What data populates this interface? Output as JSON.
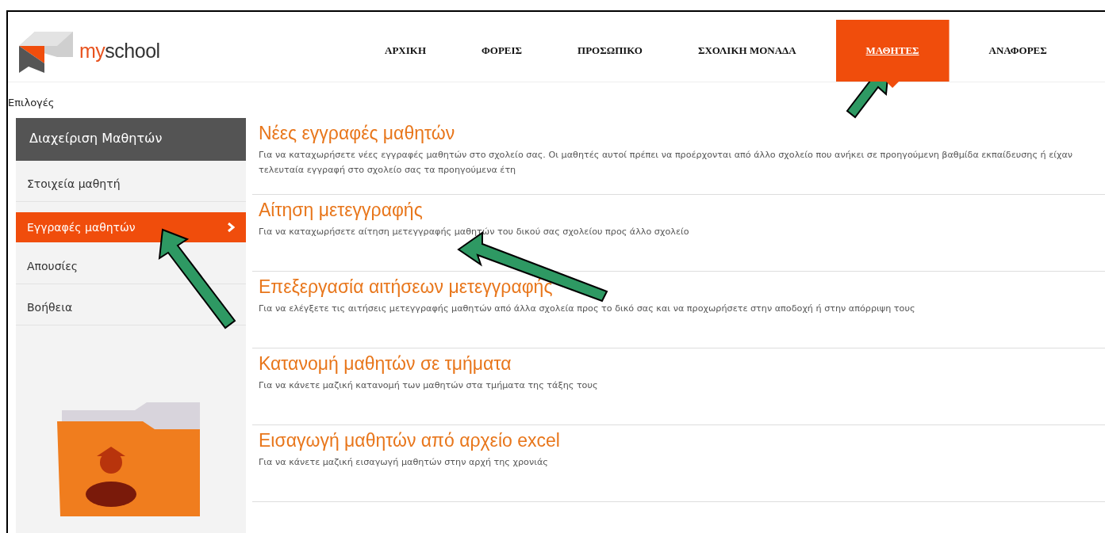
{
  "brand": {
    "name": "myschool"
  },
  "nav": [
    {
      "label": "ΑΡΧΙΚΗ",
      "selected": false
    },
    {
      "label": "ΦΟΡΕΙΣ",
      "selected": false
    },
    {
      "label": "ΠΡΟΣΩΠΙΚΟ",
      "selected": false
    },
    {
      "label": "ΣΧΟΛΙΚΗ ΜΟΝΑΔΑ",
      "selected": false
    },
    {
      "label": "ΜΑΘΗΤΕΣ",
      "selected": true
    },
    {
      "label": "ΑΝΑΦΟΡΕΣ",
      "selected": false
    }
  ],
  "breadcrumb": "Επιλογές",
  "sidebar": {
    "title": "Διαχείριση Μαθητών",
    "items": [
      {
        "label": "Στοιχεία μαθητή",
        "selected": false
      },
      {
        "label": "Εγγραφές μαθητών",
        "selected": true
      },
      {
        "label": "Απουσίες",
        "selected": false
      },
      {
        "label": "Βοήθεια",
        "selected": false
      }
    ]
  },
  "sections": [
    {
      "title": "Νέες εγγραφές μαθητών",
      "description": "Για να καταχωρήσετε νέες εγγραφές μαθητών στο σχολείο σας. Οι μαθητές αυτοί πρέπει να προέρχονται από άλλο σχολείο που ανήκει σε προηγούμενη βαθμίδα εκπαίδευσης ή είχαν τελευταία εγγραφή στο σχολείο σας τα προηγούμενα έτη"
    },
    {
      "title": "Αίτηση μετεγγραφής",
      "description": "Για να καταχωρήσετε αίτηση μετεγγραφής μαθητών του δικού σας σχολείου προς άλλο σχολείο"
    },
    {
      "title": "Επεξεργασία αιτήσεων μετεγγραφής",
      "description": "Για να ελέγξετε τις αιτήσεις μετεγγραφής μαθητών από άλλα σχολεία προς το δικό σας και να προχωρήσετε στην αποδοχή ή στην απόρριψη τους"
    },
    {
      "title": "Κατανομή μαθητών σε τμήματα",
      "description": "Για να κάνετε μαζική κατανομή των μαθητών στα τμήματα της τάξης τους"
    },
    {
      "title": "Εισαγωγή μαθητών από αρχείο excel",
      "description": "Για να κάνετε μαζική εισαγωγή μαθητών στην αρχή της χρονιάς"
    }
  ]
}
